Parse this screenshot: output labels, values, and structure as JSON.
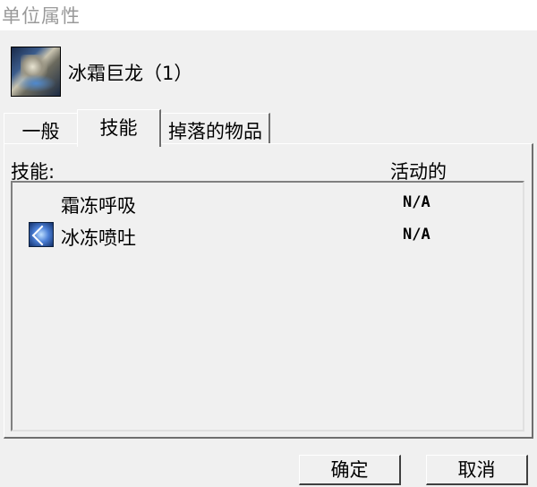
{
  "window": {
    "title": "单位属性"
  },
  "unit": {
    "name": "冰霜巨龙（1）",
    "portrait_icon": "frost-wyrm-portrait"
  },
  "tabs": [
    {
      "label": "一般",
      "selected": false
    },
    {
      "label": "技能",
      "selected": true
    },
    {
      "label": "掉落的物品",
      "selected": false
    }
  ],
  "skills_panel": {
    "col_skill": "技能:",
    "col_active": "活动的",
    "items": [
      {
        "name": "霜冻呼吸",
        "active": "N/A",
        "icon": ""
      },
      {
        "name": "冰冻喷吐",
        "active": "N/A",
        "icon": "ice-spit-icon"
      }
    ]
  },
  "buttons": {
    "ok": "确定",
    "cancel": "取消"
  }
}
